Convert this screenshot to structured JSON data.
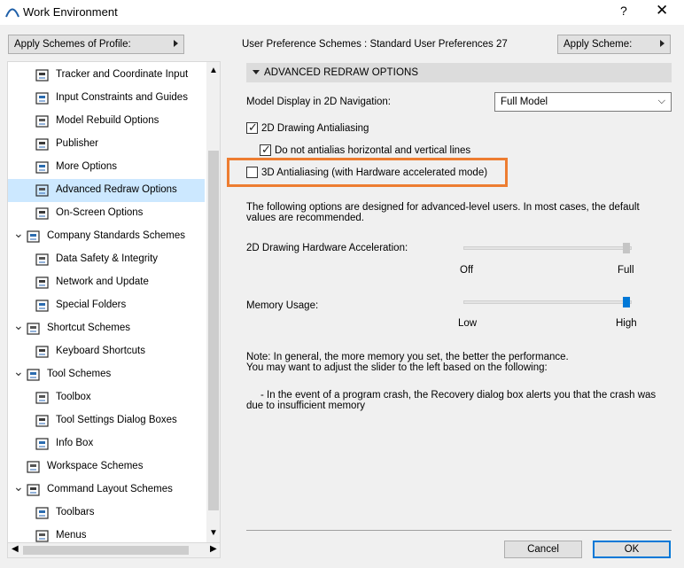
{
  "window": {
    "title": "Work Environment",
    "help": "?",
    "close": "✕"
  },
  "toolbar": {
    "profile_button": "Apply Schemes of Profile:",
    "scheme_label": "User Preference Schemes : Standard User Preferences 27",
    "apply_button": "Apply Scheme:"
  },
  "tree": {
    "items": [
      {
        "label": "Tracker and Coordinate Input",
        "icon": "tracker-icon",
        "level": 1
      },
      {
        "label": "Input Constraints and Guides",
        "icon": "constraints-icon",
        "level": 1
      },
      {
        "label": "Model Rebuild Options",
        "icon": "rebuild-icon",
        "level": 1
      },
      {
        "label": "Publisher",
        "icon": "publisher-icon",
        "level": 1
      },
      {
        "label": "More Options",
        "icon": "more-options-icon",
        "level": 1
      },
      {
        "label": "Advanced Redraw Options",
        "icon": "redraw-icon",
        "level": 1,
        "selected": true
      },
      {
        "label": "On-Screen Options",
        "icon": "onscreen-icon",
        "level": 1
      },
      {
        "label": "Company Standards Schemes",
        "icon": "company-standards-icon",
        "level": 0,
        "expanded": true
      },
      {
        "label": "Data Safety & Integrity",
        "icon": "data-safety-icon",
        "level": 1
      },
      {
        "label": "Network and Update",
        "icon": "network-icon",
        "level": 1
      },
      {
        "label": "Special Folders",
        "icon": "folders-icon",
        "level": 1
      },
      {
        "label": "Shortcut Schemes",
        "icon": "shortcut-schemes-icon",
        "level": 0,
        "expanded": true
      },
      {
        "label": "Keyboard Shortcuts",
        "icon": "keyboard-icon",
        "level": 1
      },
      {
        "label": "Tool Schemes",
        "icon": "tool-schemes-icon",
        "level": 0,
        "expanded": true
      },
      {
        "label": "Toolbox",
        "icon": "toolbox-icon",
        "level": 1
      },
      {
        "label": "Tool Settings Dialog Boxes",
        "icon": "tool-settings-icon",
        "level": 1
      },
      {
        "label": "Info Box",
        "icon": "info-box-icon",
        "level": 1
      },
      {
        "label": "Workspace Schemes",
        "icon": "workspace-icon",
        "level": 0
      },
      {
        "label": "Command Layout Schemes",
        "icon": "command-layout-icon",
        "level": 0,
        "expanded": true
      },
      {
        "label": "Toolbars",
        "icon": "toolbars-icon",
        "level": 1
      },
      {
        "label": "Menus",
        "icon": "menus-icon",
        "level": 1
      }
    ]
  },
  "panel": {
    "header": "ADVANCED REDRAW OPTIONS",
    "model_display_label": "Model Display in 2D Navigation:",
    "model_display_value": "Full Model",
    "antialiasing_2d": {
      "label": "2D Drawing Antialiasing",
      "checked": true
    },
    "no_hv_antialias": {
      "label": "Do not antialias horizontal and vertical lines",
      "checked": true
    },
    "antialiasing_3d": {
      "label": "3D Antialiasing (with Hardware accelerated mode)",
      "checked": false
    },
    "info_text_1": "The following options are designed for advanced-level users. In most cases, the default",
    "info_text_2": "values are recommended.",
    "hw_accel": {
      "label": "2D Drawing Hardware Acceleration:",
      "min": "Off",
      "max": "Full",
      "value": 1.0
    },
    "memory": {
      "label": "Memory Usage:",
      "min": "Low",
      "max": "High",
      "value": 1.0
    },
    "note_1": "Note: In general, the more memory you set, the better the performance.",
    "note_2": "You may want to adjust the slider to the left based on the following:",
    "note_3": "- In the event of a program crash, the Recovery dialog box alerts you that the crash was",
    "note_4": "due to insufficient memory"
  },
  "footer": {
    "cancel": "Cancel",
    "ok": "OK"
  },
  "colors": {
    "selection": "#cce8ff",
    "highlight": "#ed7d31",
    "accent": "#0078d7"
  }
}
